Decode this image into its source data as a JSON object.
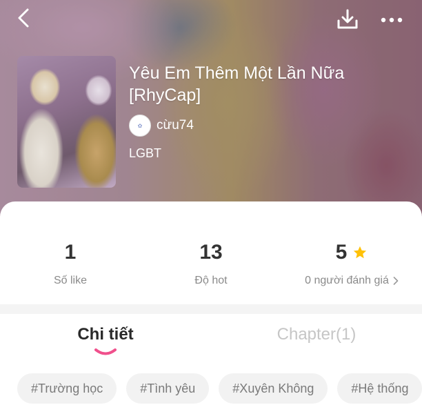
{
  "header": {
    "back_icon": "chevron-left-icon",
    "download_icon": "download-icon",
    "more_icon": "more-horizontal-icon"
  },
  "story": {
    "title": "Yêu Em Thêm Một Lần Nữa [RhyCap]",
    "author": "cừu74",
    "genre": "LGBT"
  },
  "stats": {
    "likes_value": "1",
    "likes_label": "Số like",
    "hot_value": "13",
    "hot_label": "Độ hot",
    "rating_value": "5",
    "rating_label": "0 người đánh giá",
    "star_color": "#FFC107"
  },
  "tabs": [
    {
      "label": "Chi tiết",
      "active": true
    },
    {
      "label": "Chapter(1)",
      "active": false
    }
  ],
  "tags": [
    "#Trường học",
    "#Tình yêu",
    "#Xuyên Không",
    "#Hệ thống"
  ],
  "colors": {
    "accent": "#F0508C",
    "text_dark": "#333333",
    "text_muted": "#8A8A8A",
    "tag_bg": "#F2F2F2"
  }
}
